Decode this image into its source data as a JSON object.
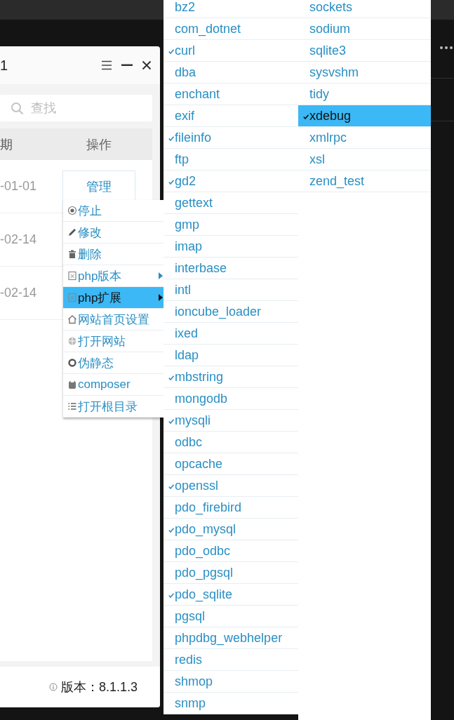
{
  "window": {
    "title": "1",
    "search": {
      "placeholder": "查找"
    },
    "table": {
      "columns": [
        "期",
        "操作"
      ],
      "rows": [
        {
          "date": "-01-01",
          "action": "管理"
        },
        {
          "date": "-02-14"
        },
        {
          "date": "-02-14"
        }
      ]
    },
    "status_bar": {
      "version": "版本：8.1.1.3"
    }
  },
  "context_menu": [
    {
      "label": "停止",
      "selected": false,
      "submenu": false
    },
    {
      "label": "修改",
      "selected": false,
      "submenu": false
    },
    {
      "label": "删除",
      "selected": false,
      "submenu": false
    },
    {
      "label": "php版本",
      "selected": false,
      "submenu": true
    },
    {
      "label": "php扩展",
      "selected": true,
      "submenu": true
    },
    {
      "label": "网站首页设置",
      "selected": false,
      "submenu": false
    },
    {
      "label": "打开网站",
      "selected": false,
      "submenu": false
    },
    {
      "label": "伪静态",
      "selected": false,
      "submenu": false
    },
    {
      "label": "composer",
      "selected": false,
      "submenu": false
    },
    {
      "label": "打开根目录",
      "selected": false,
      "submenu": false
    }
  ],
  "extensions": [
    [
      {
        "label": "bz2",
        "checked": false,
        "selected": false
      },
      {
        "label": "com_dotnet",
        "checked": false,
        "selected": false
      },
      {
        "label": "curl",
        "checked": true,
        "selected": false
      },
      {
        "label": "dba",
        "checked": false,
        "selected": false
      },
      {
        "label": "enchant",
        "checked": false,
        "selected": false
      },
      {
        "label": "exif",
        "checked": false,
        "selected": false
      },
      {
        "label": "fileinfo",
        "checked": true,
        "selected": false
      },
      {
        "label": "ftp",
        "checked": false,
        "selected": false
      },
      {
        "label": "gd2",
        "checked": true,
        "selected": false
      },
      {
        "label": "gettext",
        "checked": false,
        "selected": false
      },
      {
        "label": "gmp",
        "checked": false,
        "selected": false
      },
      {
        "label": "imap",
        "checked": false,
        "selected": false
      },
      {
        "label": "interbase",
        "checked": false,
        "selected": false
      },
      {
        "label": "intl",
        "checked": false,
        "selected": false
      },
      {
        "label": "ioncube_loader",
        "checked": false,
        "selected": false
      },
      {
        "label": "ixed",
        "checked": false,
        "selected": false
      },
      {
        "label": "ldap",
        "checked": false,
        "selected": false
      },
      {
        "label": "mbstring",
        "checked": true,
        "selected": false
      },
      {
        "label": "mongodb",
        "checked": false,
        "selected": false
      },
      {
        "label": "mysqli",
        "checked": true,
        "selected": false
      },
      {
        "label": "odbc",
        "checked": false,
        "selected": false
      },
      {
        "label": "opcache",
        "checked": false,
        "selected": false
      },
      {
        "label": "openssl",
        "checked": true,
        "selected": false
      },
      {
        "label": "pdo_firebird",
        "checked": false,
        "selected": false
      },
      {
        "label": "pdo_mysql",
        "checked": true,
        "selected": false
      },
      {
        "label": "pdo_odbc",
        "checked": false,
        "selected": false
      },
      {
        "label": "pdo_pgsql",
        "checked": false,
        "selected": false
      },
      {
        "label": "pdo_sqlite",
        "checked": true,
        "selected": false
      },
      {
        "label": "pgsql",
        "checked": false,
        "selected": false
      },
      {
        "label": "phpdbg_webhelper",
        "checked": false,
        "selected": false
      },
      {
        "label": "redis",
        "checked": false,
        "selected": false
      },
      {
        "label": "shmop",
        "checked": false,
        "selected": false
      },
      {
        "label": "snmp",
        "checked": false,
        "selected": false
      }
    ],
    [
      {
        "label": "sockets",
        "checked": false,
        "selected": false
      },
      {
        "label": "sodium",
        "checked": false,
        "selected": false
      },
      {
        "label": "sqlite3",
        "checked": false,
        "selected": false
      },
      {
        "label": "sysvshm",
        "checked": false,
        "selected": false
      },
      {
        "label": "tidy",
        "checked": false,
        "selected": false
      },
      {
        "label": "xdebug",
        "checked": true,
        "selected": true
      },
      {
        "label": "xmlrpc",
        "checked": false,
        "selected": false
      },
      {
        "label": "xsl",
        "checked": false,
        "selected": false
      },
      {
        "label": "zend_test",
        "checked": false,
        "selected": false
      }
    ]
  ]
}
